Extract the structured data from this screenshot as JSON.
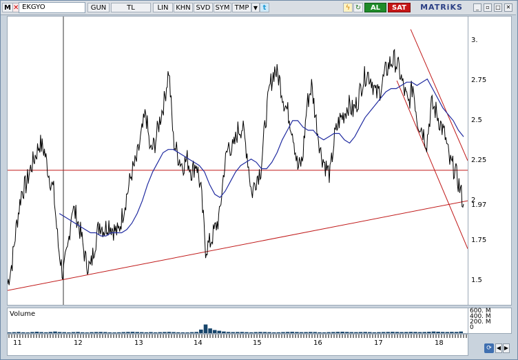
{
  "toolbar": {
    "m_label": "M",
    "symbol": "EKGYO",
    "period": "GUN",
    "currency": "TL",
    "scale_lin": "LIN",
    "khn": "KHN",
    "svd": "SVD",
    "sym": "SYM",
    "tmp": "TMP",
    "al": "AL",
    "sat": "SAT",
    "brand": "MATRiKS"
  },
  "chart_data": {
    "type": "line",
    "ylim": [
      1.35,
      3.15
    ],
    "yticks": [
      "3.",
      "2.75",
      "2.5",
      "2.25",
      "2",
      "1.97",
      "1.75",
      "1.5"
    ],
    "x_tick_labels": [
      "11",
      "12",
      "13",
      "14",
      "15",
      "16",
      "17",
      "18"
    ],
    "price": [
      1.48,
      1.62,
      1.86,
      2.05,
      2.1,
      2.2,
      2.28,
      2.36,
      2.31,
      2.16,
      2.06,
      1.72,
      1.54,
      1.68,
      1.96,
      1.9,
      1.78,
      1.62,
      1.58,
      1.74,
      1.86,
      1.82,
      1.86,
      1.82,
      1.8,
      1.92,
      2.05,
      2.18,
      2.25,
      2.4,
      2.55,
      2.3,
      2.36,
      2.5,
      2.62,
      2.82,
      2.38,
      2.28,
      2.22,
      2.26,
      2.18,
      2.24,
      2.06,
      1.7,
      1.74,
      1.82,
      1.9,
      2.2,
      2.35,
      2.32,
      2.44,
      2.46,
      2.3,
      2.04,
      2.14,
      2.2,
      2.5,
      2.72,
      2.82,
      2.76,
      2.62,
      2.54,
      2.42,
      2.2,
      2.25,
      2.6,
      2.72,
      2.5,
      2.3,
      2.22,
      2.16,
      2.4,
      2.5,
      2.54,
      2.6,
      2.56,
      2.62,
      2.74,
      2.8,
      2.76,
      2.66,
      2.7,
      2.8,
      2.86,
      2.88,
      2.82,
      2.7,
      2.6,
      2.72,
      2.5,
      2.45,
      2.36,
      2.6,
      2.56,
      2.48,
      2.4,
      2.24,
      2.2,
      2.1,
      1.98
    ],
    "moving_average": [
      null,
      null,
      null,
      null,
      null,
      null,
      null,
      null,
      null,
      null,
      1.92,
      1.9,
      1.88,
      1.86,
      1.84,
      1.82,
      1.8,
      1.8,
      1.78,
      1.78,
      1.8,
      1.8,
      1.8,
      1.82,
      1.86,
      1.92,
      2.0,
      2.1,
      2.18,
      2.24,
      2.3,
      2.32,
      2.32,
      2.3,
      2.28,
      2.26,
      2.24,
      2.22,
      2.18,
      2.1,
      2.04,
      2.02,
      2.06,
      2.12,
      2.18,
      2.22,
      2.24,
      2.26,
      2.24,
      2.2,
      2.2,
      2.24,
      2.3,
      2.38,
      2.44,
      2.5,
      2.5,
      2.46,
      2.44,
      2.44,
      2.4,
      2.38,
      2.4,
      2.42,
      2.42,
      2.38,
      2.36,
      2.4,
      2.46,
      2.52,
      2.56,
      2.6,
      2.64,
      2.68,
      2.7,
      2.7,
      2.72,
      2.74,
      2.74,
      2.72,
      2.74,
      2.76,
      2.7,
      2.64,
      2.58,
      2.54,
      2.5,
      2.44,
      2.4
    ],
    "support_line": {
      "start": [
        0,
        1.44
      ],
      "end": [
        1,
        2.0
      ]
    },
    "horizontal_line": 2.19,
    "channel_upper": {
      "start": [
        0.876,
        3.07
      ],
      "end": [
        1,
        2.25
      ]
    },
    "channel_lower": {
      "start": [
        0.846,
        2.75
      ],
      "end": [
        1,
        1.7
      ]
    },
    "volume_panel_title": "Volume",
    "volume_ticks": [
      "600. M",
      "400. M",
      "200. M",
      "0"
    ],
    "volume": [
      20,
      25,
      30,
      22,
      18,
      28,
      35,
      26,
      22,
      30,
      40,
      28,
      24,
      20,
      26,
      30,
      22,
      18,
      24,
      28,
      30,
      26,
      20,
      18,
      22,
      26,
      30,
      34,
      28,
      24,
      22,
      26,
      20,
      24,
      28,
      32,
      26,
      22,
      20,
      18,
      24,
      30,
      90,
      220,
      120,
      80,
      60,
      40,
      30,
      26,
      28,
      30,
      24,
      22,
      26,
      30,
      28,
      24,
      20,
      22,
      26,
      30,
      34,
      28,
      24,
      26,
      30,
      28,
      22,
      20,
      24,
      28,
      32,
      36,
      30,
      26,
      24,
      28,
      30,
      26,
      22,
      24,
      28,
      30,
      34,
      30,
      26,
      28,
      32,
      30,
      26,
      28,
      34,
      40,
      36,
      30,
      28,
      32,
      30,
      40
    ]
  }
}
